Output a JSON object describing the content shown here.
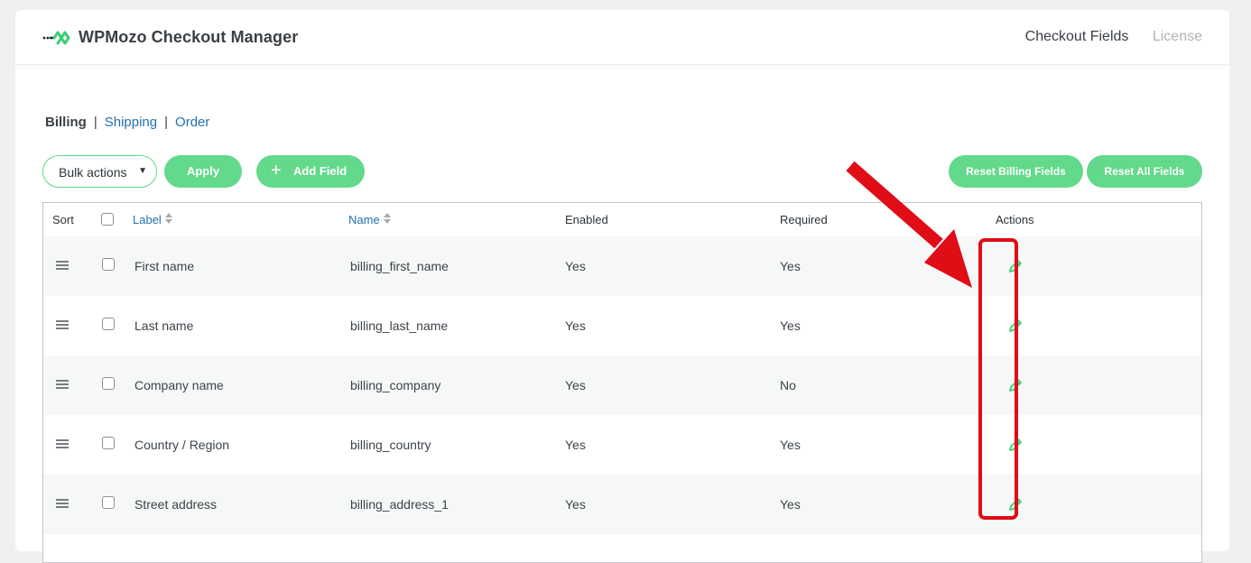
{
  "header": {
    "brand": "WPMozo Checkout Manager",
    "nav": [
      {
        "label": "Checkout Fields",
        "active": true
      },
      {
        "label": "License",
        "active": false
      }
    ]
  },
  "subnav": {
    "billing": "Billing",
    "shipping": "Shipping",
    "order": "Order",
    "separator": "|"
  },
  "toolbar": {
    "bulk_actions": "Bulk actions",
    "apply": "Apply",
    "add_field": "Add Field",
    "reset_billing": "Reset Billing Fields",
    "reset_all": "Reset All Fields"
  },
  "table": {
    "headers": {
      "sort": "Sort",
      "label": "Label",
      "name": "Name",
      "enabled": "Enabled",
      "required": "Required",
      "actions": "Actions"
    },
    "rows": [
      {
        "label": "First name",
        "name": "billing_first_name",
        "enabled": "Yes",
        "required": "Yes"
      },
      {
        "label": "Last name",
        "name": "billing_last_name",
        "enabled": "Yes",
        "required": "Yes"
      },
      {
        "label": "Company name",
        "name": "billing_company",
        "enabled": "Yes",
        "required": "No"
      },
      {
        "label": "Country / Region",
        "name": "billing_country",
        "enabled": "Yes",
        "required": "Yes"
      },
      {
        "label": "Street address",
        "name": "billing_address_1",
        "enabled": "Yes",
        "required": "Yes"
      }
    ]
  },
  "colors": {
    "accent_green": "#62d98b",
    "link_blue": "#2271b1",
    "annotation_red": "#e00c16"
  },
  "icons": [
    "brand-logo-icon",
    "caret-down-icon",
    "plus-icon",
    "sort-arrows-icon",
    "drag-handle-icon",
    "pencil-icon",
    "annotation-arrow"
  ]
}
